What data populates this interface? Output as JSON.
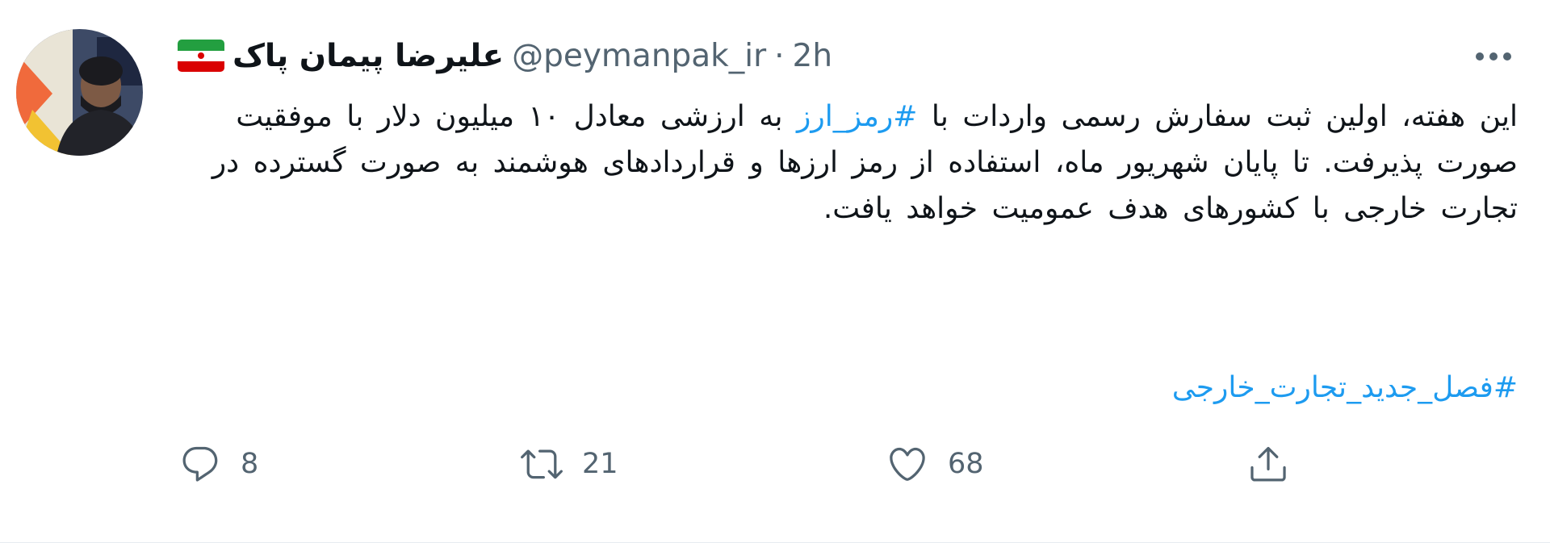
{
  "author": {
    "display_name": "علیرضا پیمان پاک",
    "handle": "@peymanpak_ir",
    "separator": "·",
    "time": "2h",
    "flag_icon": "iran-flag-icon"
  },
  "tweet": {
    "line1_before": "این هفته، اولین ثبت سفارش رسمی واردات با ",
    "hashtag1": "#رمز_ارز",
    "line1_after": " به ارزشی معادل ۱۰",
    "rest": "میلیون دلار با موفقیت صورت پذیرفت. تا پایان شهریور ماه، استفاده از رمز ارزها و قراردادهای هوشمند به صورت گسترده در تجارت خارجی با کشورهای هدف عمومیت خواهد یافت.",
    "hashtag2": "#فصل_جدید_تجارت_خارجی"
  },
  "actions": {
    "reply_count": "8",
    "retweet_count": "21",
    "like_count": "68"
  },
  "colors": {
    "link": "#1d9bf0",
    "muted": "#536471",
    "text": "#0f1419"
  }
}
